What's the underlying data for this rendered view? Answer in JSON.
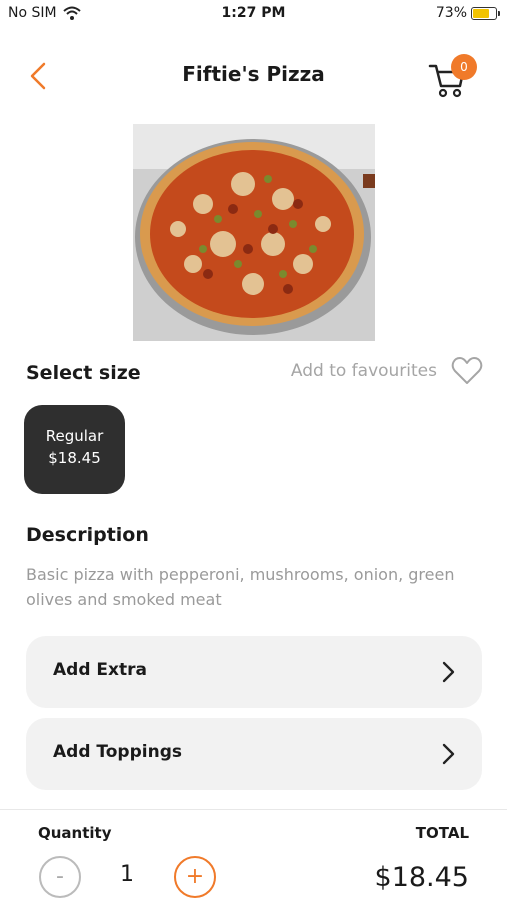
{
  "status_bar": {
    "carrier": "No SIM",
    "time": "1:27 PM",
    "battery": "73%",
    "battery_level": 0.73,
    "battery_color": "#f2c300"
  },
  "header": {
    "title": "Fiftie's Pizza",
    "back_icon": "chevron-left-icon",
    "cart_icon": "cart-icon",
    "cart_count": "0"
  },
  "product": {
    "image_alt": "pizza-photo"
  },
  "size_section": {
    "label": "Select size",
    "favourites_label": "Add to favourites",
    "favourites_icon": "heart-icon",
    "options": [
      {
        "name": "Regular",
        "price": "$18.45",
        "selected": true
      }
    ]
  },
  "description": {
    "title": "Description",
    "text": "Basic pizza with pepperoni, mushrooms, onion, green olives and smoked meat"
  },
  "options": [
    {
      "label": "Add Extra"
    },
    {
      "label": "Add Toppings"
    }
  ],
  "footer": {
    "quantity_label": "Quantity",
    "quantity": "1",
    "minus": "-",
    "plus": "+",
    "total_label": "TOTAL",
    "total": "$18.45"
  },
  "colors": {
    "accent": "#f07a2a",
    "chip_bg": "#2f2f2f",
    "row_bg": "#f2f2f2",
    "muted_text": "#9a9a9a"
  }
}
